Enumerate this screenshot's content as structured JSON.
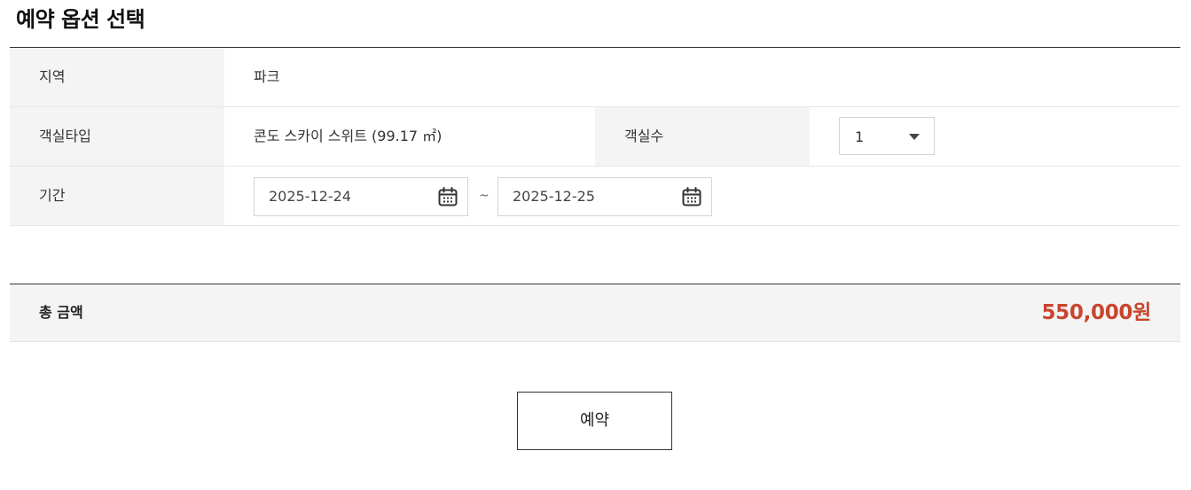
{
  "title": "예약 옵션 선택",
  "rows": {
    "region": {
      "label": "지역",
      "value": "파크"
    },
    "room_type": {
      "label": "객실타입",
      "value": "콘도 스카이 스위트 (99.17 ㎡)",
      "count_label": "객실수",
      "count_value": "1"
    },
    "period": {
      "label": "기간",
      "start_date": "2025-12-24",
      "separator": "~",
      "end_date": "2025-12-25"
    }
  },
  "total": {
    "label": "총 금액",
    "value": "550,000원"
  },
  "reserve_button_label": "예약",
  "icons": {
    "calendar": "calendar-icon",
    "dropdown": "caret-down-icon"
  },
  "colors": {
    "accent": "#c9452f",
    "header_bg": "#f4f4f4",
    "border_dark": "#333333"
  }
}
